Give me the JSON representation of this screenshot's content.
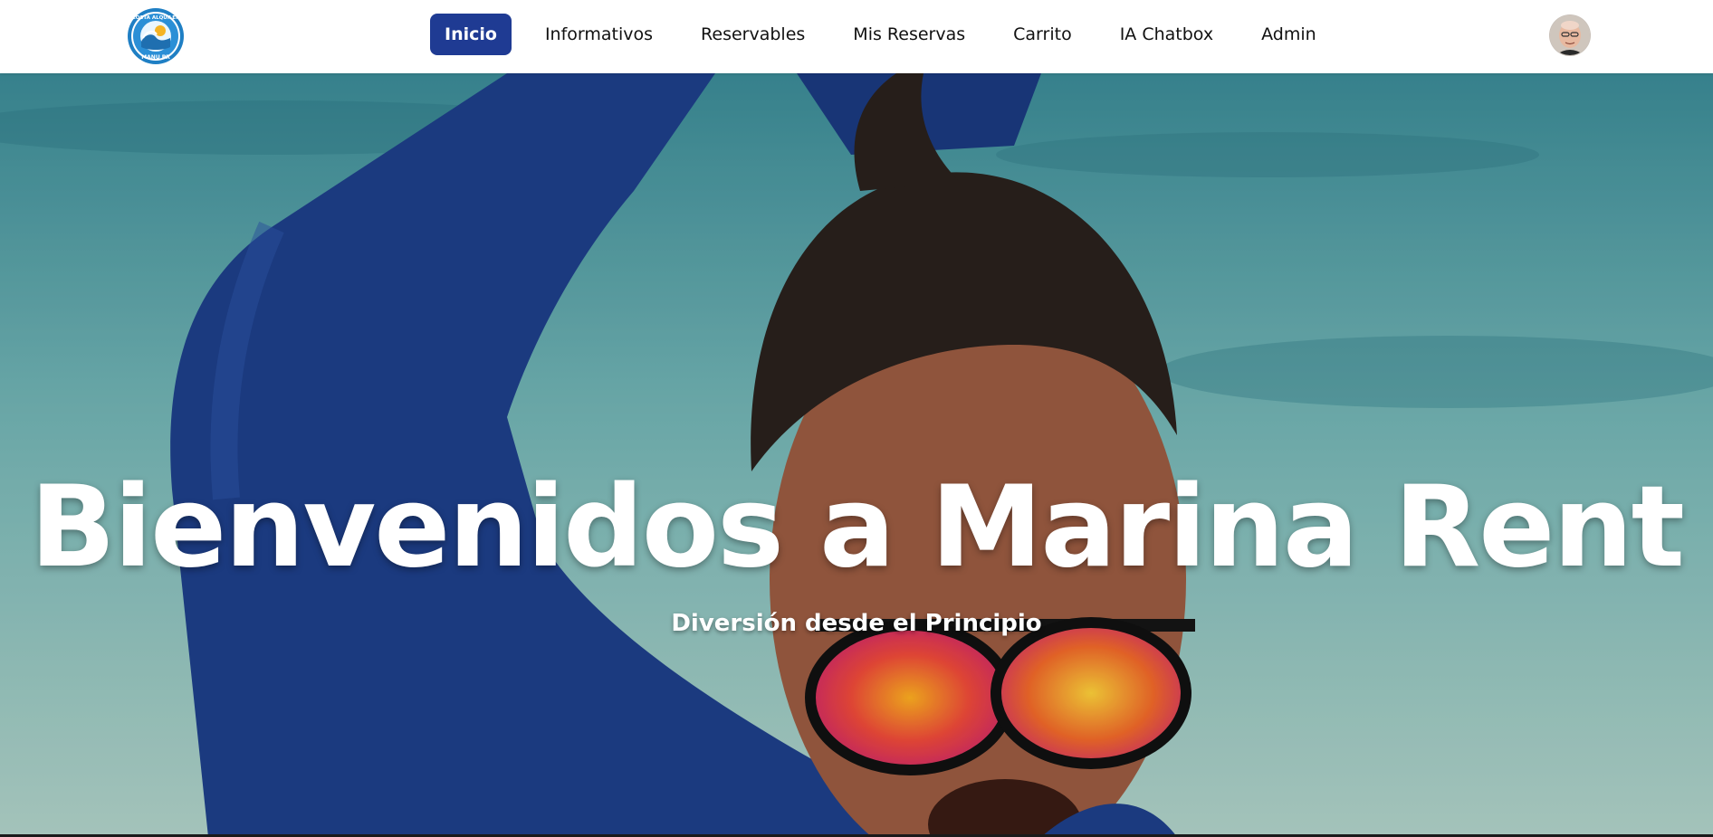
{
  "brand": {
    "logo_text_top": "COSTA ALQUILER",
    "logo_text_bottom": "MANU PR",
    "logo_icon": "wave-logo-icon"
  },
  "nav": {
    "items": [
      {
        "label": "Inicio",
        "active": true
      },
      {
        "label": "Informativos",
        "active": false
      },
      {
        "label": "Reservables",
        "active": false
      },
      {
        "label": "Mis Reservas",
        "active": false
      },
      {
        "label": "Carrito",
        "active": false
      },
      {
        "label": "IA Chatbox",
        "active": false
      },
      {
        "label": "Admin",
        "active": false
      }
    ],
    "active_color": "#1f3b93"
  },
  "user": {
    "avatar_icon": "user-avatar-icon"
  },
  "hero": {
    "title": "Bienvenidos a Marina Rent",
    "subtitle": "Diversión desde el Principio",
    "background_icon": "hero-video-background"
  }
}
